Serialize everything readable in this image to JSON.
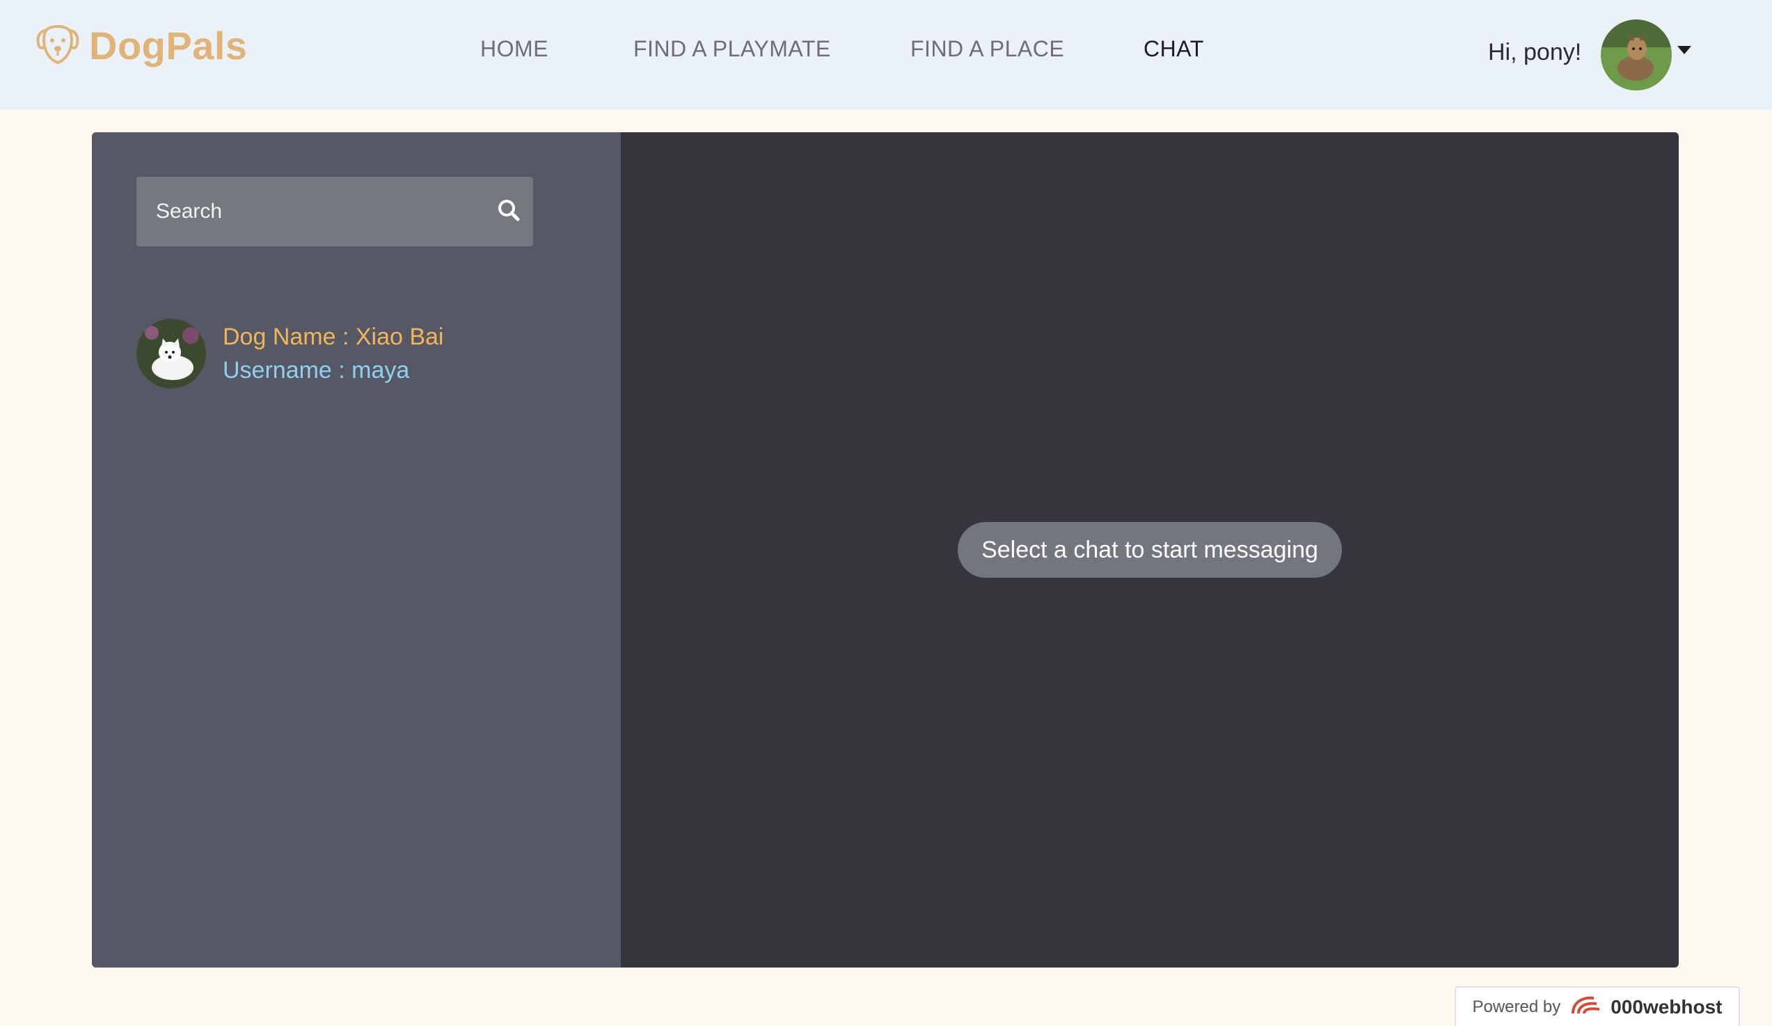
{
  "brand": {
    "name": "DogPals",
    "color": "#e0b478",
    "icon": "dog-face-icon"
  },
  "nav": {
    "items": [
      {
        "label": "HOME",
        "active": false
      },
      {
        "label": "FIND A PLAYMATE",
        "active": false
      },
      {
        "label": "FIND A PLACE",
        "active": false
      },
      {
        "label": "CHAT",
        "active": true
      }
    ]
  },
  "user": {
    "greeting": "Hi, pony!",
    "avatar_icon": "dog-avatar-icon",
    "menu_icon": "caret-down-icon"
  },
  "sidebar": {
    "search": {
      "placeholder": "Search",
      "value": "",
      "icon": "search-icon"
    },
    "contacts": [
      {
        "dog_name": "Dog Name : Xiao Bai",
        "username": "Username : maya",
        "avatar_icon": "white-dog-avatar-icon"
      }
    ]
  },
  "chat": {
    "empty_message": "Select a chat to start messaging"
  },
  "footer": {
    "powered_label": "Powered by",
    "powered_brand": "000webhost"
  },
  "colors": {
    "header_bg": "#eaf2f8",
    "sidebar_bg": "#565965",
    "chat_bg": "#34363b",
    "dog_name": "#f2b65a",
    "username": "#8fd0ee"
  }
}
